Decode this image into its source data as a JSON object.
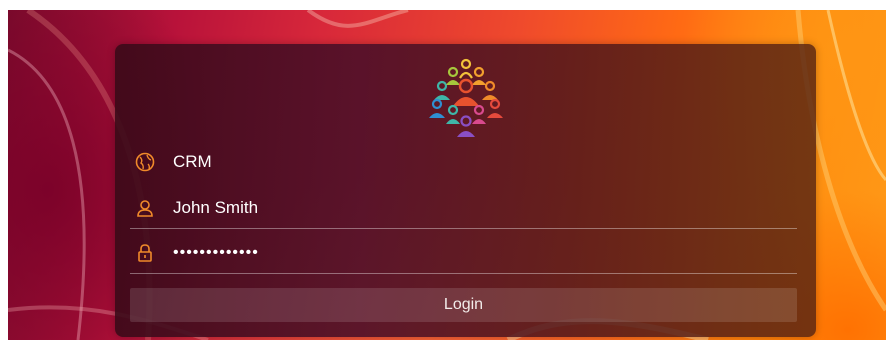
{
  "login_form": {
    "server": {
      "value": "CRM",
      "icon": "globe-icon"
    },
    "username": {
      "value": "John Smith",
      "icon": "user-icon"
    },
    "password": {
      "value": "•••••••••••••",
      "icon": "lock-icon"
    },
    "login_button": "Login",
    "logo_icon": "team-people-icon"
  },
  "colors": {
    "icon_accent": "#f08a2a",
    "text": "#ffffff",
    "divider": "rgba(255,255,255,0.38)",
    "panel_overlay": "#3a0a18"
  }
}
